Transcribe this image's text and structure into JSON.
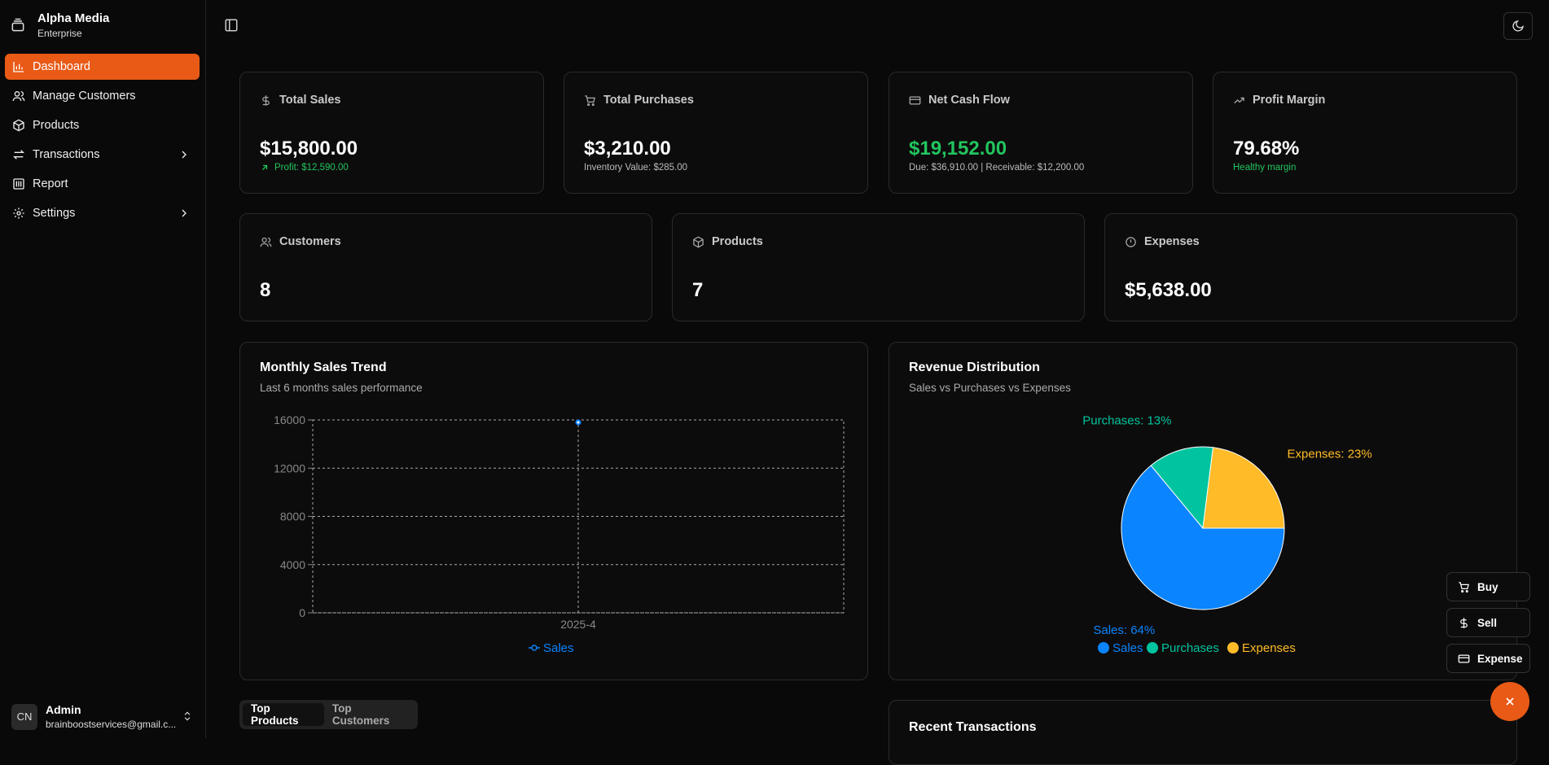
{
  "brand": {
    "name": "Alpha Media",
    "sub": "Enterprise"
  },
  "nav": [
    {
      "label": "Dashboard",
      "icon": "bar-chart-icon",
      "active": true
    },
    {
      "label": "Manage Customers",
      "icon": "users-icon"
    },
    {
      "label": "Products",
      "icon": "package-icon"
    },
    {
      "label": "Transactions",
      "icon": "arrows-icon",
      "chevron": true
    },
    {
      "label": "Report",
      "icon": "report-icon"
    },
    {
      "label": "Settings",
      "icon": "gear-icon",
      "chevron": true
    }
  ],
  "user": {
    "initials": "CN",
    "name": "Admin",
    "email": "brainboostservices@gmail.c..."
  },
  "stats": {
    "total_sales": {
      "title": "Total Sales",
      "value": "$15,800.00",
      "sub": "Profit: $12,590.00"
    },
    "total_purchases": {
      "title": "Total Purchases",
      "value": "$3,210.00",
      "sub": "Inventory Value: $285.00"
    },
    "net_cash_flow": {
      "title": "Net Cash Flow",
      "value": "$19,152.00",
      "sub": "Due: $36,910.00 | Receivable: $12,200.00"
    },
    "profit_margin": {
      "title": "Profit Margin",
      "value": "79.68%",
      "sub": "Healthy margin"
    },
    "customers": {
      "title": "Customers",
      "value": "8"
    },
    "products": {
      "title": "Products",
      "value": "7"
    },
    "expenses": {
      "title": "Expenses",
      "value": "$5,638.00"
    }
  },
  "sales_panel": {
    "title": "Monthly Sales Trend",
    "subtitle": "Last 6 months sales performance"
  },
  "revenue_panel": {
    "title": "Revenue Distribution",
    "subtitle": "Sales vs Purchases vs Expenses"
  },
  "recent_panel": {
    "title": "Recent Transactions"
  },
  "tabs": [
    "Top Products",
    "Top Customers"
  ],
  "quick_actions": {
    "buy": "Buy",
    "sell": "Sell",
    "expense": "Expense"
  },
  "colors": {
    "accent": "#e85a16",
    "sales": "#0a84ff",
    "purchases": "#00c49f",
    "expenses": "#ffbb28",
    "positive": "#22c55e"
  },
  "chart_data": [
    {
      "type": "line",
      "x": [
        "2025-4"
      ],
      "series": [
        {
          "name": "Sales",
          "values": [
            15800
          ]
        }
      ],
      "yticks": [
        0,
        4000,
        8000,
        12000,
        16000
      ],
      "ylim": [
        0,
        16000
      ],
      "grid": true,
      "legend": "bottom"
    },
    {
      "type": "pie",
      "slices": [
        {
          "name": "Sales",
          "label": "Sales: 64%",
          "value": 64
        },
        {
          "name": "Purchases",
          "label": "Purchases: 13%",
          "value": 13
        },
        {
          "name": "Expenses",
          "label": "Expenses: 23%",
          "value": 23
        }
      ],
      "legend": "bottom"
    }
  ]
}
